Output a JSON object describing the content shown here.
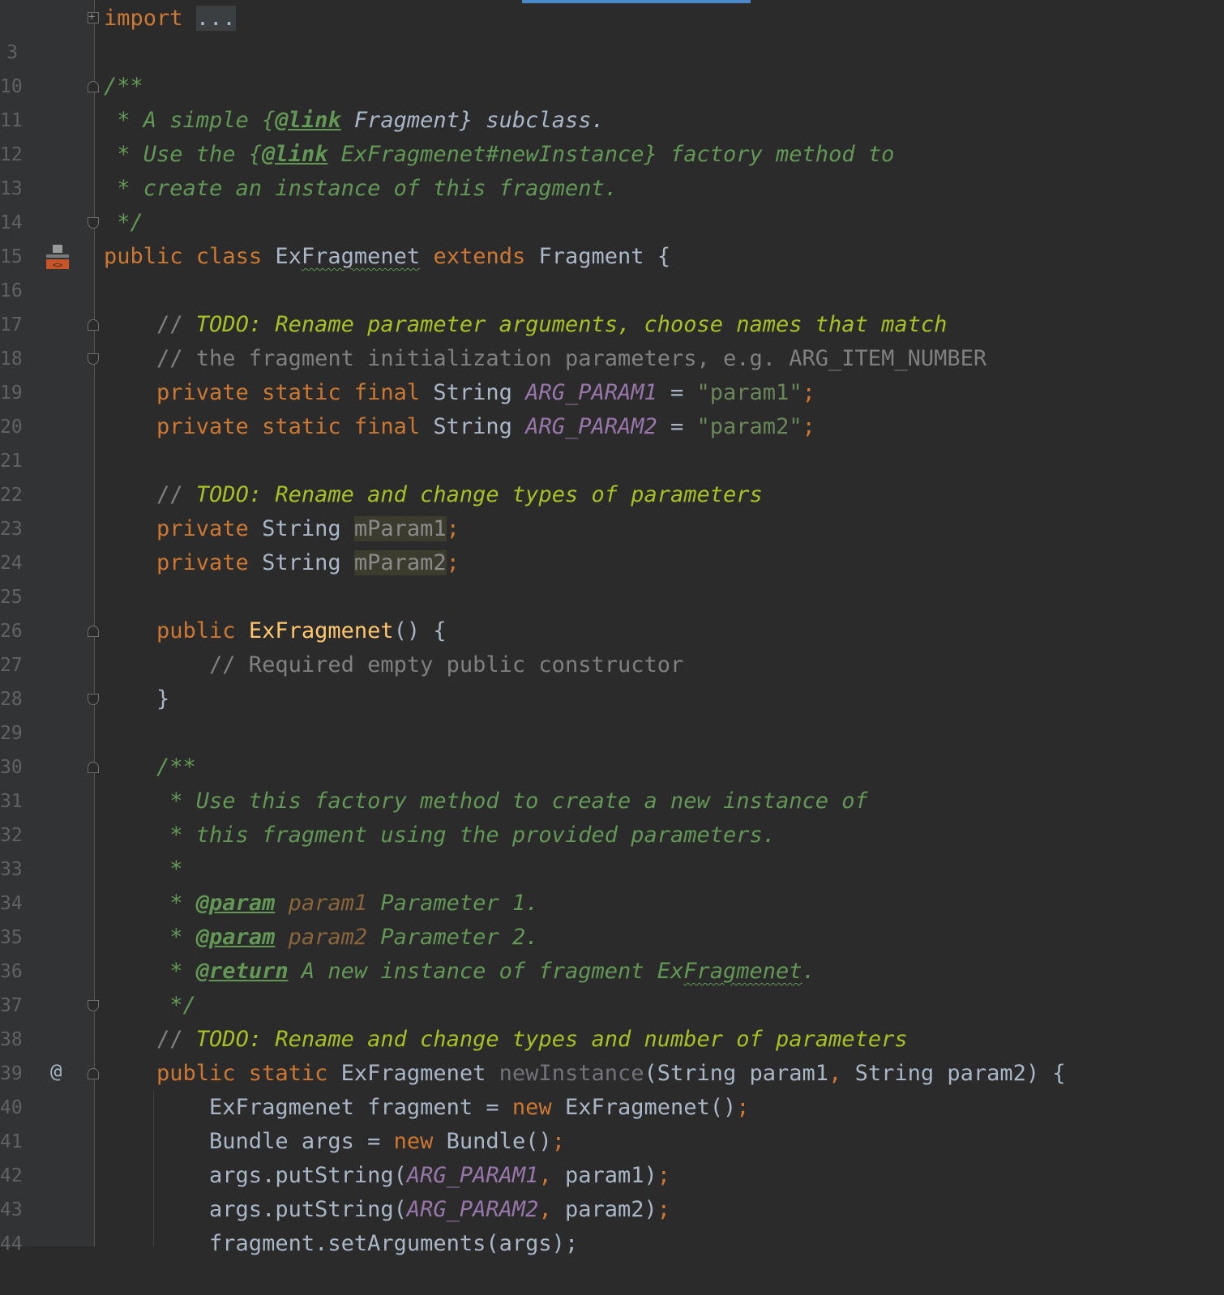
{
  "editor": {
    "line_numbers": [
      "3",
      "10",
      "11",
      "12",
      "13",
      "14",
      "15",
      "16",
      "17",
      "18",
      "19",
      "20",
      "21",
      "22",
      "23",
      "24",
      "25",
      "26",
      "27",
      "28",
      "29",
      "30",
      "31",
      "32",
      "33",
      "34",
      "35",
      "36",
      "37",
      "38",
      "39",
      "40",
      "41",
      "42",
      "43",
      "44"
    ],
    "import_keyword": "import",
    "import_folded": "...",
    "class_doc": {
      "open": "/**",
      "l1_a": " * A simple {",
      "l1_tag": "@link",
      "l1_b": " Fragment} subclass.",
      "l2_a": " * Use the {",
      "l2_tag": "@link",
      "l2_b": " ExFragmenet#newInstance} factory method to",
      "l3": " * create an instance of this fragment.",
      "close": " */"
    },
    "class_decl": {
      "public": "public",
      "class": "class",
      "name_a": "Ex",
      "name_b": "Fragmenet",
      "extends": "extends",
      "super": "Fragment {"
    },
    "todo1": {
      "prefix": "    // ",
      "text": "TODO: Rename parameter arguments, choose names that match"
    },
    "comment2": "    // the fragment initialization parameters, e.g. ARG_ITEM_NUMBER",
    "field1": {
      "mods": "    private static final",
      "type": " String ",
      "name": "ARG_PARAM1",
      "eq": " = ",
      "value": "\"param1\"",
      "semi": ";"
    },
    "field2": {
      "mods": "    private static final",
      "type": " String ",
      "name": "ARG_PARAM2",
      "eq": " = ",
      "value": "\"param2\"",
      "semi": ";"
    },
    "todo2": {
      "prefix": "    // ",
      "text": "TODO: Rename and change types of parameters"
    },
    "mfield1": {
      "mods": "    private",
      "type": " String ",
      "name": "mParam1",
      "semi": ";"
    },
    "mfield2": {
      "mods": "    private",
      "type": " String ",
      "name": "mParam2",
      "semi": ";"
    },
    "ctor": {
      "mods": "    public ",
      "name": "ExFragmenet",
      "rest": "() {"
    },
    "ctor_comment": "        // Required empty public constructor",
    "ctor_close": "    }",
    "method_doc": {
      "open": "    /**",
      "l1": "     * Use this factory method to create a new instance of",
      "l2": "     * this fragment using the provided parameters.",
      "l3": "     *",
      "p1_pre": "     * ",
      "p1_tag": "@param",
      "p1_name": " param1",
      "p1_desc": " Parameter 1.",
      "p2_pre": "     * ",
      "p2_tag": "@param",
      "p2_name": " param2",
      "p2_desc": " Parameter 2.",
      "r_pre": "     * ",
      "r_tag": "@return",
      "r_desc_a": " A new instance of fragment Ex",
      "r_desc_b": "Fragmenet",
      "r_desc_c": ".",
      "close": "     */"
    },
    "todo3": {
      "prefix": "    // ",
      "text": "TODO: Rename and change types and number of parameters"
    },
    "method": {
      "mods": "    public static",
      "ret": " ExFragmenet ",
      "name": "newInstance",
      "p_a": "(String param1",
      "comma": ",",
      "p_b": " String param2) {"
    },
    "body1": {
      "a": "        ExFragmenet fragment = ",
      "new": "new",
      "b": " ExFragmenet()",
      "semi": ";"
    },
    "body2": {
      "a": "        Bundle args = ",
      "new": "new",
      "b": " Bundle()",
      "semi": ";"
    },
    "body3": {
      "a": "        args.putString(",
      "c": "ARG_PARAM1",
      "comma": ",",
      "b": " param1)",
      "semi": ";"
    },
    "body4": {
      "a": "        args.putString(",
      "c": "ARG_PARAM2",
      "comma": ",",
      "b": " param2)",
      "semi": ";"
    },
    "body5": "        fragment.setArguments(args);",
    "gutter_at": "@"
  },
  "colors": {
    "background": "#2b2b2b",
    "keyword": "#cc7832",
    "string": "#6a8759",
    "constant": "#9876aa",
    "function": "#ffc66d",
    "doc": "#629755",
    "todo": "#a8c023"
  }
}
